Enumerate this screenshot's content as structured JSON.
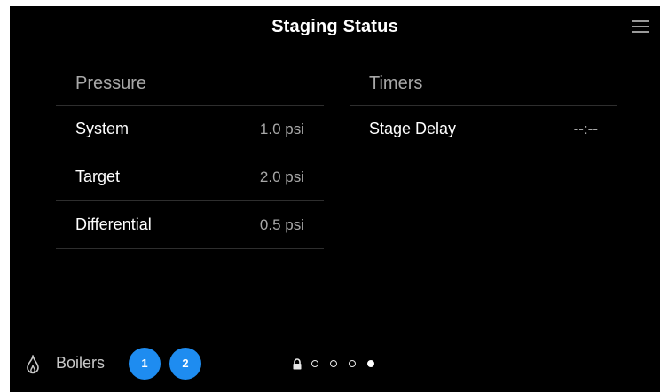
{
  "header": {
    "title": "Staging Status"
  },
  "pressure": {
    "title": "Pressure",
    "rows": [
      {
        "label": "System",
        "value": "1.0 psi"
      },
      {
        "label": "Target",
        "value": "2.0 psi"
      },
      {
        "label": "Differential",
        "value": "0.5 psi"
      }
    ]
  },
  "timers": {
    "title": "Timers",
    "rows": [
      {
        "label": "Stage Delay",
        "value": "--:--"
      }
    ]
  },
  "footer": {
    "boilers_label": "Boilers",
    "boilers": [
      "1",
      "2"
    ],
    "pager": {
      "pages": 4,
      "active_page": 4
    }
  },
  "icons": {
    "menu": "menu-icon",
    "flame": "flame-icon",
    "lock": "lock-icon"
  },
  "colors": {
    "background": "#000000",
    "accent": "#1e8cf0",
    "text": "#ffffff",
    "muted_text": "#a8a8a8",
    "divider": "#2e2e2e"
  }
}
